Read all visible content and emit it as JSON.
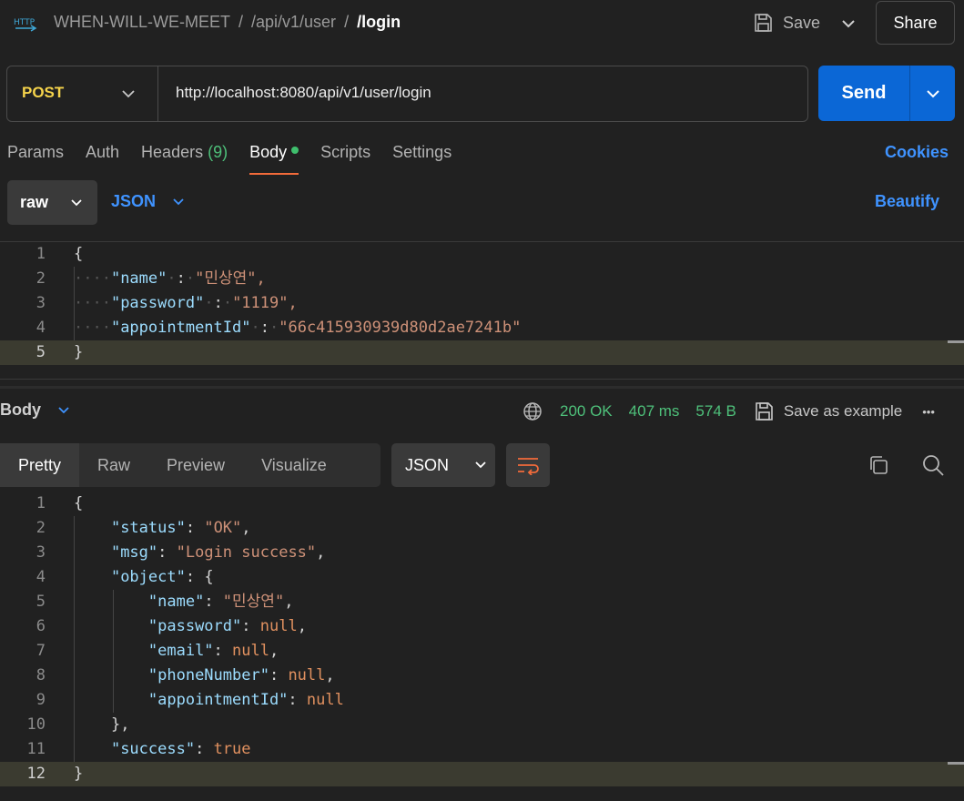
{
  "header": {
    "breadcrumb": [
      "WHEN-WILL-WE-MEET",
      "/api/v1/user",
      "/login"
    ],
    "save_label": "Save",
    "share_label": "Share"
  },
  "request": {
    "method": "POST",
    "url": "http://localhost:8080/api/v1/user/login",
    "send_label": "Send"
  },
  "tabs": {
    "params": "Params",
    "auth": "Auth",
    "headers": "Headers",
    "headers_count": "(9)",
    "body": "Body",
    "scripts": "Scripts",
    "settings": "Settings",
    "cookies": "Cookies"
  },
  "body_options": {
    "mode": "raw",
    "format": "JSON",
    "beautify": "Beautify"
  },
  "request_body": {
    "line_numbers": [
      "1",
      "2",
      "3",
      "4",
      "5"
    ],
    "open": "{",
    "close": "}",
    "fields": [
      {
        "key": "\"name\"",
        "value": "\"민상연\","
      },
      {
        "key": "\"password\"",
        "value": "\"1119\","
      },
      {
        "key": "\"appointmentId\"",
        "value": "\"66c415930939d80d2ae7241b\""
      }
    ]
  },
  "response": {
    "body_label": "Body",
    "status": "200 OK",
    "time": "407 ms",
    "size": "574 B",
    "save_example": "Save as example",
    "more": "•••",
    "view_tabs": [
      "Pretty",
      "Raw",
      "Preview",
      "Visualize"
    ],
    "format": "JSON",
    "line_numbers": [
      "1",
      "2",
      "3",
      "4",
      "5",
      "6",
      "7",
      "8",
      "9",
      "10",
      "11",
      "12"
    ],
    "lines": {
      "l1": "{",
      "status_key": "\"status\"",
      "status_val": "\"OK\"",
      "msg_key": "\"msg\"",
      "msg_val": "\"Login success\"",
      "object_key": "\"object\"",
      "name_key": "\"name\"",
      "name_val": "\"민상연\"",
      "password_key": "\"password\"",
      "password_val": "null",
      "email_key": "\"email\"",
      "email_val": "null",
      "phone_key": "\"phoneNumber\"",
      "phone_val": "null",
      "appt_key": "\"appointmentId\"",
      "appt_val": "null",
      "l10": "},",
      "success_key": "\"success\"",
      "success_val": "true",
      "l12": "}"
    }
  },
  "colors": {
    "accent_blue": "#0b67d6",
    "link_blue": "#3f93ff",
    "method_post": "#f5d34b",
    "status_green": "#4ec07a",
    "active_tab_underline": "#f26b3a"
  },
  "icons": [
    "http-icon",
    "save-icon",
    "chevron-down-icon",
    "globe-icon",
    "copy-icon",
    "search-icon",
    "wrap-lines-icon"
  ]
}
